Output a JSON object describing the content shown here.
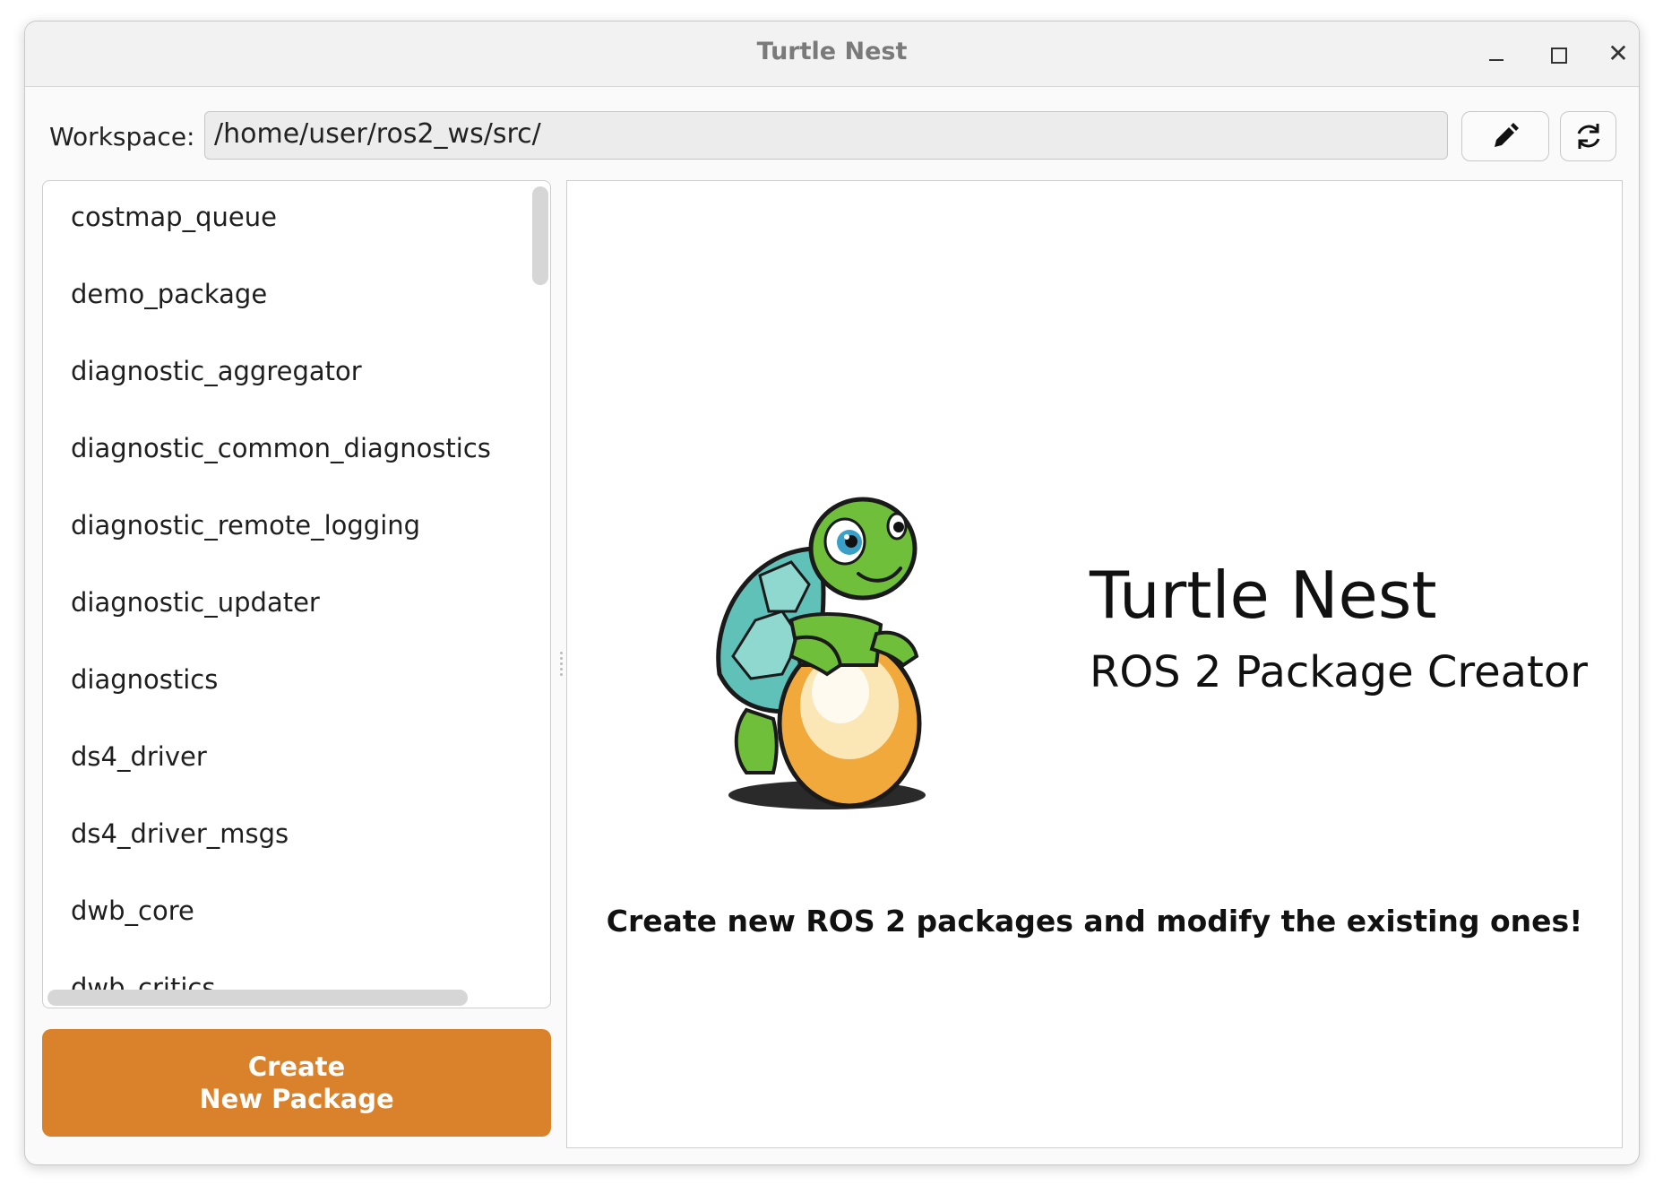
{
  "window": {
    "title": "Turtle Nest",
    "controls": [
      "minimize-icon",
      "maximize-icon",
      "close-icon"
    ]
  },
  "workspace": {
    "label": "Workspace:",
    "path": "/home/user/ros2_ws/src/",
    "edit_icon": "pencil-icon",
    "refresh_icon": "refresh-icon"
  },
  "packages": [
    "costmap_queue",
    "demo_package",
    "diagnostic_aggregator",
    "diagnostic_common_diagnostics",
    "diagnostic_remote_logging",
    "diagnostic_updater",
    "diagnostics",
    "ds4_driver",
    "ds4_driver_msgs",
    "dwb_core",
    "dwb_critics"
  ],
  "create_button": {
    "line1": "Create",
    "line2": "New Package"
  },
  "main": {
    "app_name": "Turtle Nest",
    "app_subtitle": "ROS 2 Package Creator",
    "tagline": "Create new ROS 2 packages and modify the existing ones!"
  },
  "colors": {
    "accent": "#d9822b",
    "turtle_green": "#6fbf3a",
    "shell_teal": "#5fc1b8",
    "egg_orange": "#f2a93b"
  }
}
